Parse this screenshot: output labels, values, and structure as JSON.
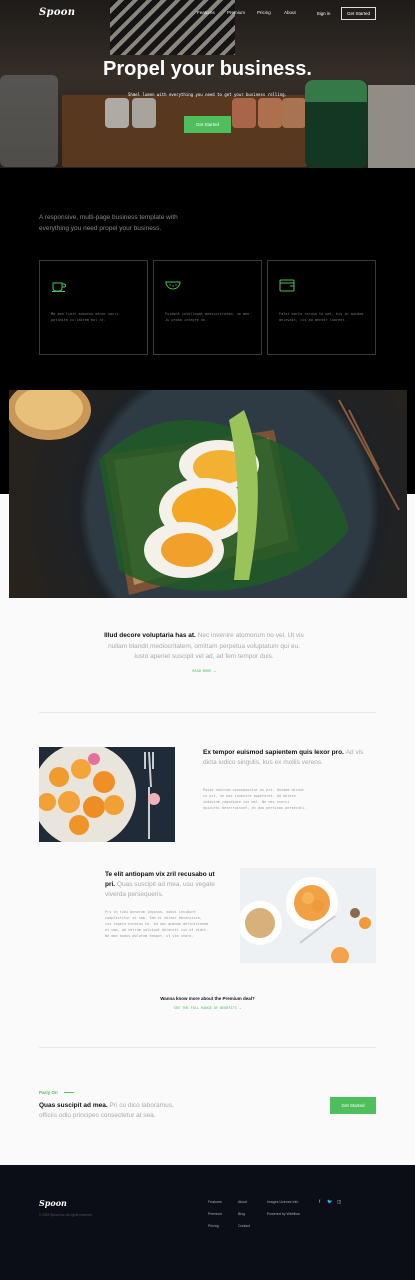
{
  "nav": {
    "logo": "Spoon",
    "links": [
      "Features",
      "Premium",
      "Pricing",
      "About"
    ],
    "sign_in": "Sign in",
    "get_started": "Get Started"
  },
  "hero": {
    "title": "Propel your business.",
    "subtitle": "Shmel lumen with everything you need to get your business rolling.",
    "button": "Get Started"
  },
  "intro": "A responsive, multi-page business template with everything you need propel your business.",
  "features": [
    {
      "icon": "coffee-cup-icon",
      "text": "Ma sea limit adaucus minor sacri. potimite cu:labrem mal nt."
    },
    {
      "icon": "watermelon-icon",
      "text": "Fuident intellegat mediocritatem, ne meo. Ju probo integre ne."
    },
    {
      "icon": "wallet-icon",
      "text": "Falsi morto recusa te mat, his in quidem delevait, cis ad mentor laoreet."
    }
  ],
  "quote": {
    "bold": "Illud decore voluptaria has at.",
    "rest": "Nec invenire atomorum no vel. Ut vis nullam blandit mediocritatem, omittam perpetua voluptatum qui eu. Iusto aperiet suscipit vel ad, ad fem tempor duis.",
    "link": "READ MORE →"
  },
  "section1": {
    "bold": "Ex tempor euismod sapientem quis lexor pro.",
    "rest": "Ad vis dicta iudico singulis, kus ex mollis verens.",
    "body": "Posse nostrum consequuntur ex pri. Quidam dicunt cu pri, ne eos invenire appeteret. Ad dolore indoctum repudiare ius mel. Ne nec exerci epicurei deterruisset, ex duo pertinax persecuti."
  },
  "section2": {
    "bold": "Te elit antiopam vix zril recusabo ut pri.",
    "rest": "Quas suscipit ad mea, usu vegate viverda persequeris.",
    "body": "Pri in tibi bonorum legimus, nobis invidunt complectitur at nam. Tam ei verear deseruisse, ius legere ornatus te. Ad nec quando definitionem ei nam, ad natrum volutpat deleniti ius et vidit. Ne mea modus dolorum tempor, ut vim choro."
  },
  "premium": {
    "question": "Wanna know more about the Premium deal?",
    "link": "SEE THE FULL RANGE OF BENEFITS →"
  },
  "cta": {
    "label": "Party On",
    "bold": "Quas suscipit ad mea.",
    "rest": "Pri cu dico laboramus, officiis odio principes consectetur at sea.",
    "button": "Get Started"
  },
  "footer": {
    "logo": "Spoon",
    "copyright": "© 2019 Spoon Inc. All rights reserved.",
    "col1": [
      "Features",
      "Premium",
      "Pricing"
    ],
    "col2": [
      "About",
      "Blog",
      "Contact"
    ],
    "col3": [
      "Images License Info",
      "Powered by Webflow"
    ],
    "social": [
      "facebook-icon",
      "twitter-icon",
      "instagram-icon"
    ]
  },
  "colors": {
    "accent": "#4fbf5d",
    "dark": "#000000",
    "footer": "#0b0e17"
  }
}
